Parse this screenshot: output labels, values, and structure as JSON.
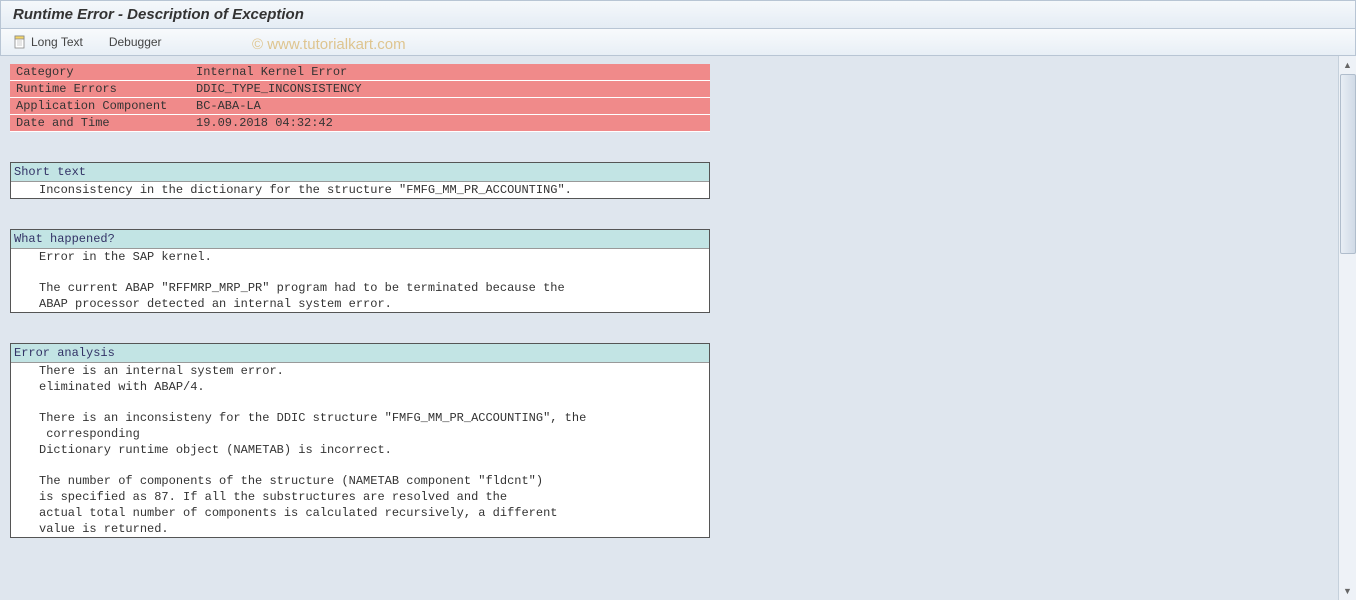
{
  "title": "Runtime Error - Description of Exception",
  "toolbar": {
    "long_text_label": "Long Text",
    "debugger_label": "Debugger"
  },
  "info": {
    "category_label": "Category",
    "category_value": "Internal Kernel Error",
    "runtime_errors_label": "Runtime Errors",
    "runtime_errors_value": "DDIC_TYPE_INCONSISTENCY",
    "app_component_label": "Application Component",
    "app_component_value": "BC-ABA-LA",
    "datetime_label": "Date and Time",
    "datetime_value": "19.09.2018 04:32:42"
  },
  "short_text": {
    "header": "Short text",
    "line1": "Inconsistency in the dictionary for the structure \"FMFG_MM_PR_ACCOUNTING\"."
  },
  "what_happened": {
    "header": "What happened?",
    "line1": "Error in the SAP kernel.",
    "line2": "",
    "line3": "The current ABAP \"RFFMRP_MRP_PR\" program had to be terminated because the",
    "line4": "ABAP processor detected an internal system error."
  },
  "error_analysis": {
    "header": "Error analysis",
    "line1": "There is an internal system error.",
    "line2": "eliminated with ABAP/4.",
    "line3": "",
    "line4": "There is an inconsisteny for the DDIC structure \"FMFG_MM_PR_ACCOUNTING\", the",
    "line5": " corresponding",
    "line6": "Dictionary runtime object (NAMETAB) is incorrect.",
    "line7": "",
    "line8": "The number of components of the structure (NAMETAB component \"fldcnt\")",
    "line9": "is specified as 87. If all the substructures are resolved and the",
    "line10": "actual total number of components is calculated recursively, a different",
    "line11": "value is returned."
  },
  "watermark": "© www.tutorialkart.com"
}
